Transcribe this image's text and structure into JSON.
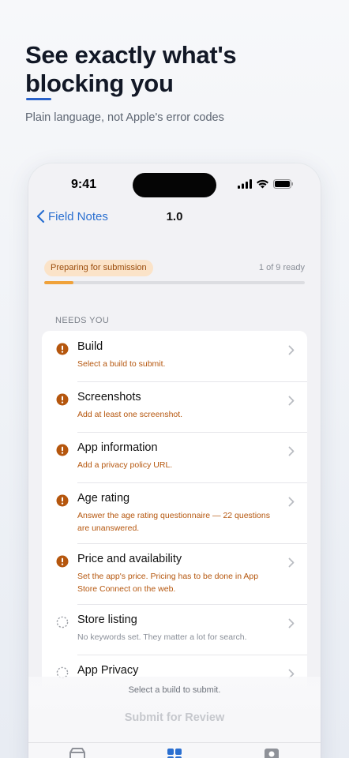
{
  "hero": {
    "headline_line1": "See exactly what's",
    "headline_line2": "blocking you",
    "subhead": "Plain language, not Apple's error codes"
  },
  "status_bar": {
    "time": "9:41",
    "icons": [
      "cellular-signal-icon",
      "wifi-icon",
      "battery-icon"
    ]
  },
  "nav": {
    "back_label": "Field Notes",
    "title": "1.0"
  },
  "progress": {
    "badge": "Preparing for submission",
    "count": "1 of 9 ready",
    "fraction": 0.111
  },
  "section": {
    "header": "NEEDS YOU"
  },
  "items": [
    {
      "title": "Build",
      "subtitle": "Select a build to submit.",
      "status": "blocking"
    },
    {
      "title": "Screenshots",
      "subtitle": "Add at least one screenshot.",
      "status": "blocking"
    },
    {
      "title": "App information",
      "subtitle": "Add a privacy policy URL.",
      "status": "blocking"
    },
    {
      "title": "Age rating",
      "subtitle": "Answer the age rating questionnaire — 22 questions are unanswered.",
      "status": "blocking"
    },
    {
      "title": "Price and availability",
      "subtitle": "Set the app's price. Pricing has to be done in App Store Connect on the web.",
      "status": "blocking"
    },
    {
      "title": "Store listing",
      "subtitle": "No keywords set. They matter a lot for search.",
      "status": "pending"
    },
    {
      "title": "App Privacy",
      "subtitle": "",
      "status": "pending"
    }
  ],
  "footer": {
    "blocker_message": "Select a build to submit.",
    "submit_label": "Submit for Review"
  },
  "tabs": [
    {
      "icon": "archive-box-icon"
    },
    {
      "icon": "grid-icon"
    },
    {
      "icon": "person-icon"
    }
  ],
  "colors": {
    "accent": "#2a6fd0",
    "warning": "#b5560d",
    "progress": "#f0a23a"
  }
}
